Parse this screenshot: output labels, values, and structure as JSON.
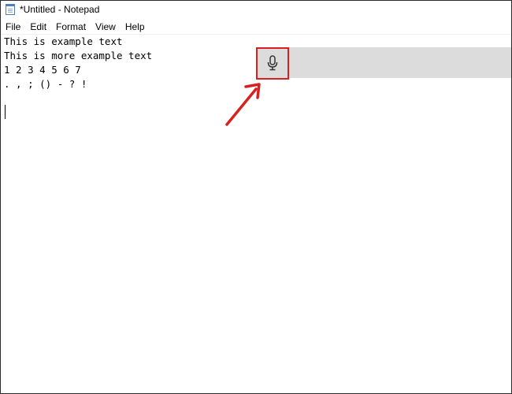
{
  "window": {
    "title": "*Untitled - Notepad",
    "app_icon": "notepad-icon"
  },
  "menu": {
    "items": [
      "File",
      "Edit",
      "Format",
      "View",
      "Help"
    ]
  },
  "editor": {
    "lines": [
      "This is example text",
      "This is more example text",
      "1 2 3 4 5 6 7",
      ". , ; () - ? !"
    ]
  },
  "dictation": {
    "icon": "microphone-icon",
    "highlight_color": "#d92020",
    "bar_color": "#dcdcdc"
  },
  "annotation": {
    "icon": "red-arrow-icon",
    "color": "#d92020"
  }
}
